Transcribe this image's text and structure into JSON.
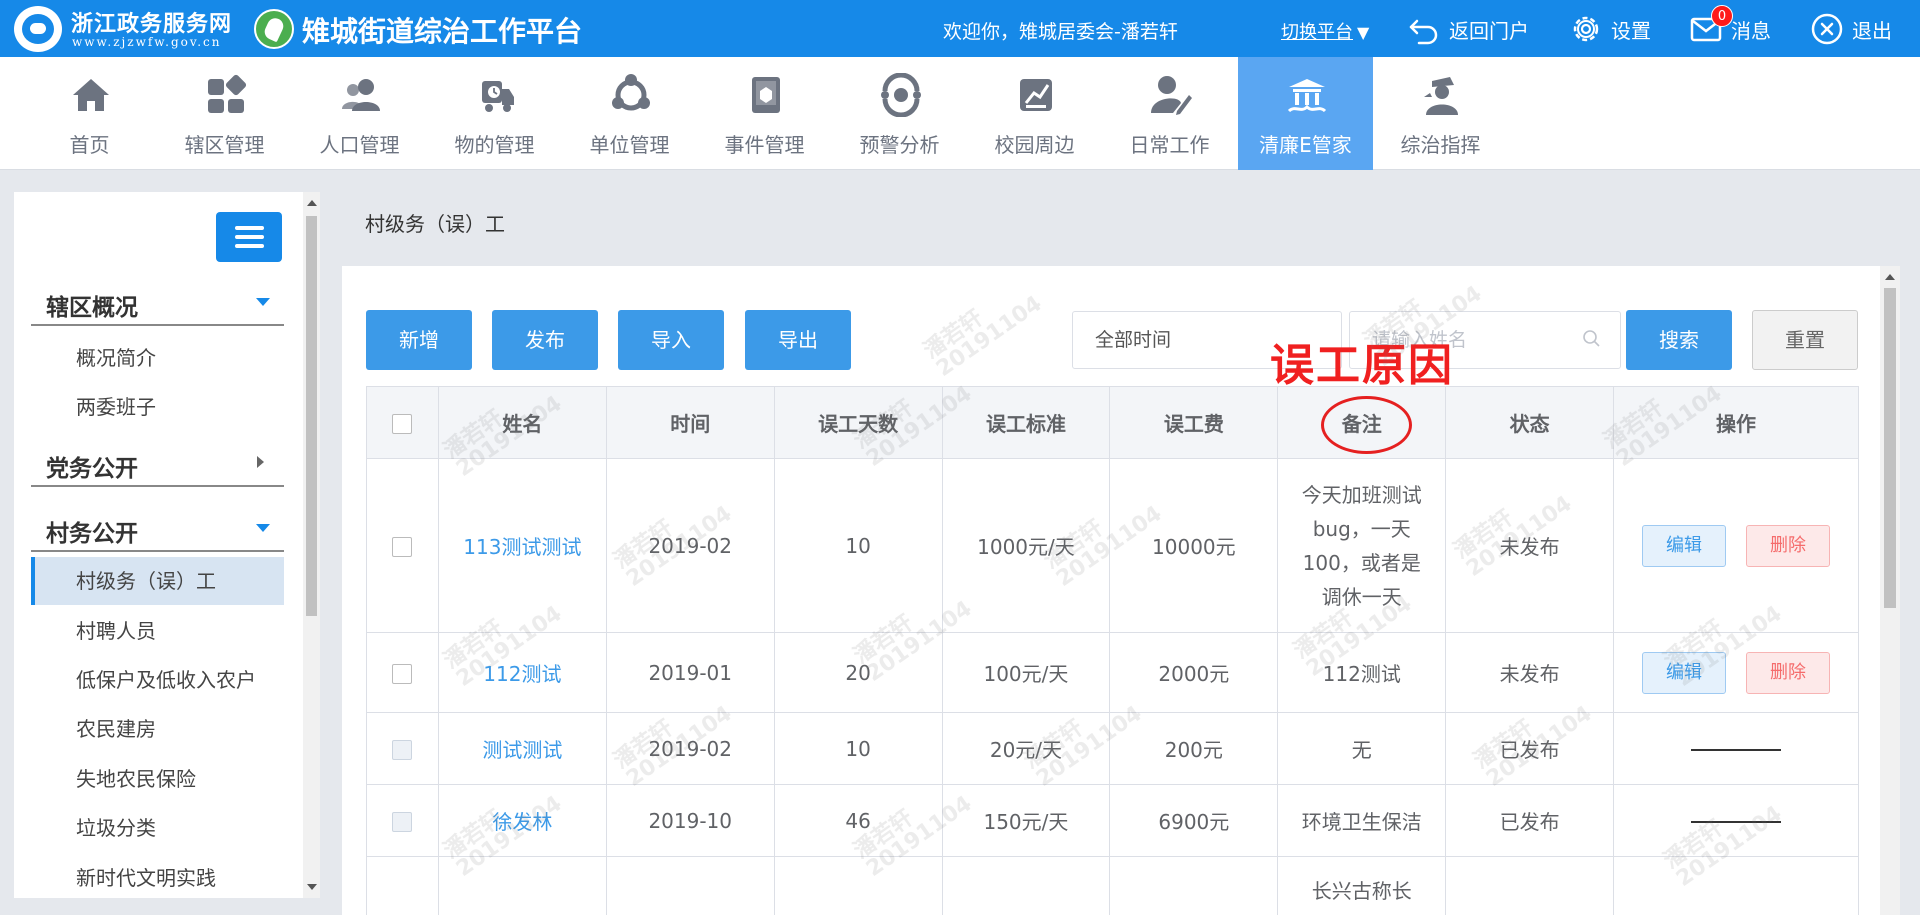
{
  "header": {
    "site_name": "浙江政务服务网",
    "site_domain": "www.zjzwfw.gov.cn",
    "platform_title": "雉城街道综治工作平台",
    "welcome": "欢迎你，雉城居委会-潘若轩",
    "switch_platform": "切换平台",
    "return_portal": "返回门户",
    "settings": "设置",
    "messages": "消息",
    "message_count": "0",
    "logout": "退出"
  },
  "nav": [
    {
      "label": "首页",
      "icon": "home-icon"
    },
    {
      "label": "辖区管理",
      "icon": "grid-icon"
    },
    {
      "label": "人口管理",
      "icon": "people-icon"
    },
    {
      "label": "物的管理",
      "icon": "truck-icon"
    },
    {
      "label": "单位管理",
      "icon": "organization-icon"
    },
    {
      "label": "事件管理",
      "icon": "book-icon"
    },
    {
      "label": "预警分析",
      "icon": "analysis-icon"
    },
    {
      "label": "校园周边",
      "icon": "school-icon"
    },
    {
      "label": "日常工作",
      "icon": "user-edit-icon"
    },
    {
      "label": "清廉E管家",
      "icon": "landmark-icon",
      "active": true
    },
    {
      "label": "综治指挥",
      "icon": "officer-icon"
    }
  ],
  "sidebar": {
    "sections": [
      {
        "label": "辖区概况",
        "expanded": true,
        "items": [
          "概况简介",
          "两委班子"
        ]
      },
      {
        "label": "党务公开",
        "expanded": false,
        "items": []
      },
      {
        "label": "村务公开",
        "expanded": true,
        "items": [
          "村级务（误）工",
          "村聘人员",
          "低保户及低收入农户",
          "农民建房",
          "失地农民保险",
          "垃圾分类",
          "新时代文明实践"
        ]
      }
    ],
    "active_item": "村级务（误）工"
  },
  "breadcrumb": "村级务（误）工",
  "toolbar": {
    "add": "新增",
    "publish": "发布",
    "import": "导入",
    "export": "导出",
    "time_filter": "全部时间",
    "name_placeholder": "请输入姓名",
    "search": "搜索",
    "reset": "重置"
  },
  "annotation": "误工原因",
  "watermark": {
    "name": "潘若轩",
    "date": "20191104"
  },
  "table": {
    "headers": [
      "姓名",
      "时间",
      "误工天数",
      "误工标准",
      "误工费",
      "备注",
      "状态",
      "操作"
    ],
    "rows": [
      {
        "name": "113测试测试",
        "time": "2019-02",
        "days": "10",
        "standard": "1000元/天",
        "fee": "10000元",
        "remark": "今天加班测试bug，一天100，或者是调休一天",
        "status": "未发布",
        "actions": [
          "编辑",
          "删除"
        ],
        "checkbox_enabled": true
      },
      {
        "name": "112测试",
        "time": "2019-01",
        "days": "20",
        "standard": "100元/天",
        "fee": "2000元",
        "remark": "112测试",
        "status": "未发布",
        "actions": [
          "编辑",
          "删除"
        ],
        "checkbox_enabled": true
      },
      {
        "name": "测试测试",
        "time": "2019-02",
        "days": "10",
        "standard": "20元/天",
        "fee": "200元",
        "remark": "无",
        "status": "已发布",
        "actions": [],
        "checkbox_enabled": false
      },
      {
        "name": "徐发林",
        "time": "2019-10",
        "days": "46",
        "standard": "150元/天",
        "fee": "6900元",
        "remark": "环境卫生保洁",
        "status": "已发布",
        "actions": [],
        "checkbox_enabled": false
      },
      {
        "name": "",
        "time": "",
        "days": "",
        "standard": "",
        "fee": "",
        "remark": "长兴古称长",
        "status": "",
        "actions": [],
        "checkbox_enabled": false
      }
    ]
  },
  "colors": {
    "primary": "#1689e8",
    "button": "#3c9ae8",
    "nav_active": "#5aa6f2",
    "annotation": "#f02020",
    "danger": "#f56c6c"
  }
}
